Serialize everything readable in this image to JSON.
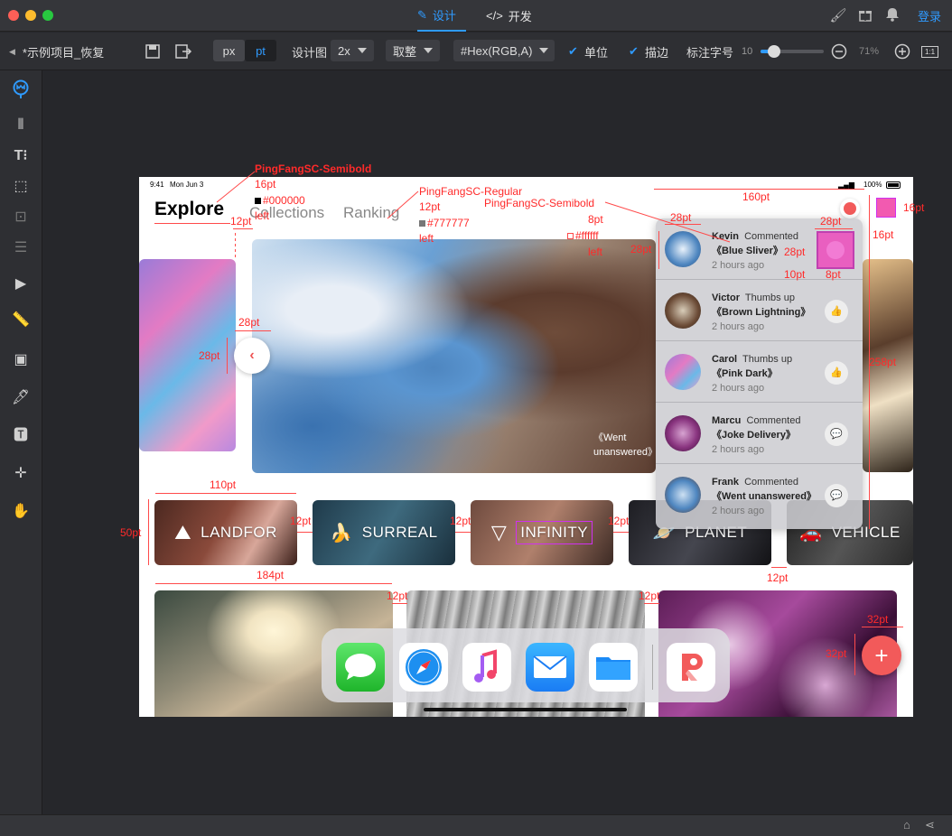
{
  "titlebar": {
    "tab_design": "设计",
    "tab_dev": "开发",
    "login": "登录",
    "icons": [
      "brush-icon",
      "gift-icon",
      "bell-icon"
    ]
  },
  "toolbar": {
    "project_name": "*示例项目_恢复",
    "unit_px": "px",
    "unit_pt": "pt",
    "design_label": "设计图",
    "design_scale": "2x",
    "round_label": "取整",
    "color_format": "#Hex(RGB,A)",
    "unit_check": "单位",
    "stroke_check": "描边",
    "font_size_label": "标注字号",
    "font_size_value": "10",
    "zoom": "71%",
    "ratio_btn": "1:1"
  },
  "artboard": {
    "status_time": "9:41",
    "status_date": "Mon Jun 3",
    "battery": "100%",
    "nav": [
      "Explore",
      "Collections",
      "Ranking"
    ],
    "caption": "《Went unanswered》",
    "chips": [
      "LANDFOR",
      "SURREAL",
      "INFINITY",
      "PLANET",
      "VEHICLE"
    ],
    "notifications": [
      {
        "name": "Kevin",
        "action": "Commented",
        "title": "《Blue Sliver》",
        "time": "2 hours ago"
      },
      {
        "name": "Victor",
        "action": "Thumbs up",
        "title": "《Brown Lightning》",
        "time": "2 hours ago"
      },
      {
        "name": "Carol",
        "action": "Thumbs up",
        "title": "《Pink Dark》",
        "time": "2 hours ago"
      },
      {
        "name": "Marcu",
        "action": "Commented",
        "title": "《Joke Delivery》",
        "time": "2 hours ago"
      },
      {
        "name": "Frank",
        "action": "Commented",
        "title": "《Went unanswered》",
        "time": "2 hours ago"
      }
    ],
    "dock_apps": [
      "messages-app-icon",
      "safari-app-icon",
      "music-app-icon",
      "mail-app-icon",
      "files-app-icon",
      "p-app-icon"
    ]
  },
  "annotations": {
    "font1": "PingFangSC-Semibold",
    "font1_size": "16pt",
    "font1_color": "#000000",
    "font1_align": "left",
    "font2": "PingFangSC-Regular",
    "font2_size": "12pt",
    "font2_color": "#777777",
    "font2_align": "left",
    "font3": "PingFangSC-Semibold",
    "font3_size": "8pt",
    "font3_color": "#ffffff",
    "font3_align": "left",
    "m_12pt": "12pt",
    "m_28pt": "28pt",
    "m_110pt": "110pt",
    "m_50pt": "50pt",
    "m_184pt": "184pt",
    "m_160pt": "160pt",
    "m_16pt": "16pt",
    "m_10pt": "10pt",
    "m_8pt": "8pt",
    "m_258pt": "258pt",
    "m_32pt": "32pt"
  },
  "colors": {
    "accent": "#2f9bff",
    "annotation": "#ff2a2a",
    "fab": "#f25a5a"
  }
}
